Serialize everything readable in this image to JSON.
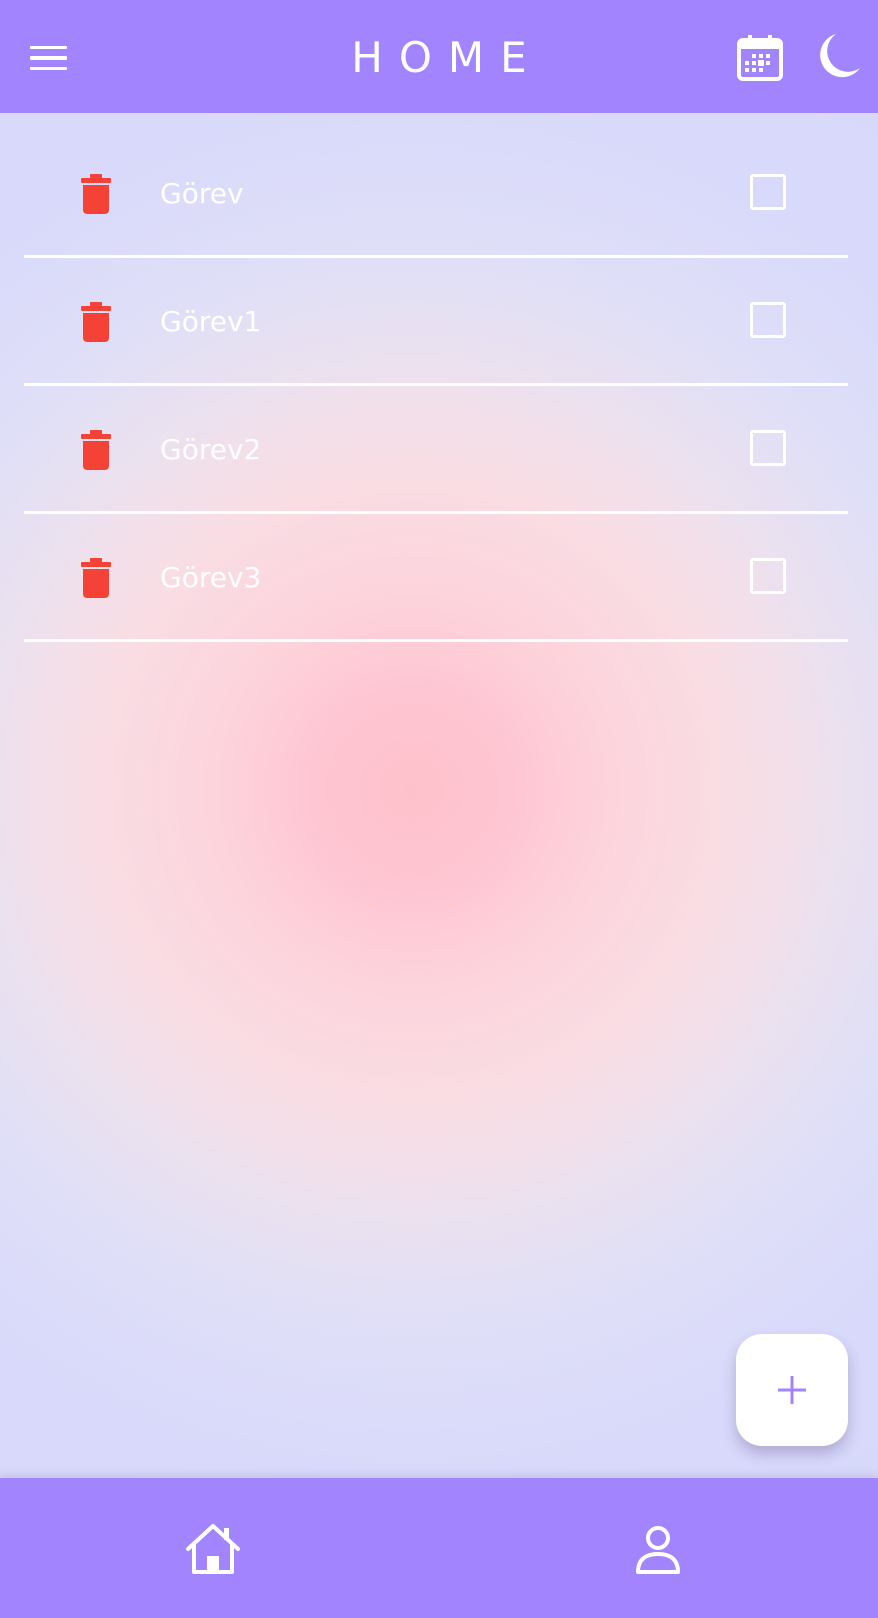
{
  "header": {
    "title": "HOME",
    "menu_icon": "hamburger-menu-icon",
    "calendar_icon": "calendar-icon",
    "theme_icon": "moon-icon"
  },
  "tasks": [
    {
      "label": "Görev",
      "done": false
    },
    {
      "label": "Görev1",
      "done": false
    },
    {
      "label": "Görev2",
      "done": false
    },
    {
      "label": "Görev3",
      "done": false
    }
  ],
  "icons": {
    "delete": "trash-icon",
    "add": "plus-icon",
    "nav_home": "home-icon",
    "nav_profile": "person-icon"
  },
  "colors": {
    "primary": "#a284fe",
    "delete": "#f44336",
    "on_primary": "#ffffff",
    "background_center": "#fec1cb",
    "background_edge": "#d6d8fb"
  }
}
